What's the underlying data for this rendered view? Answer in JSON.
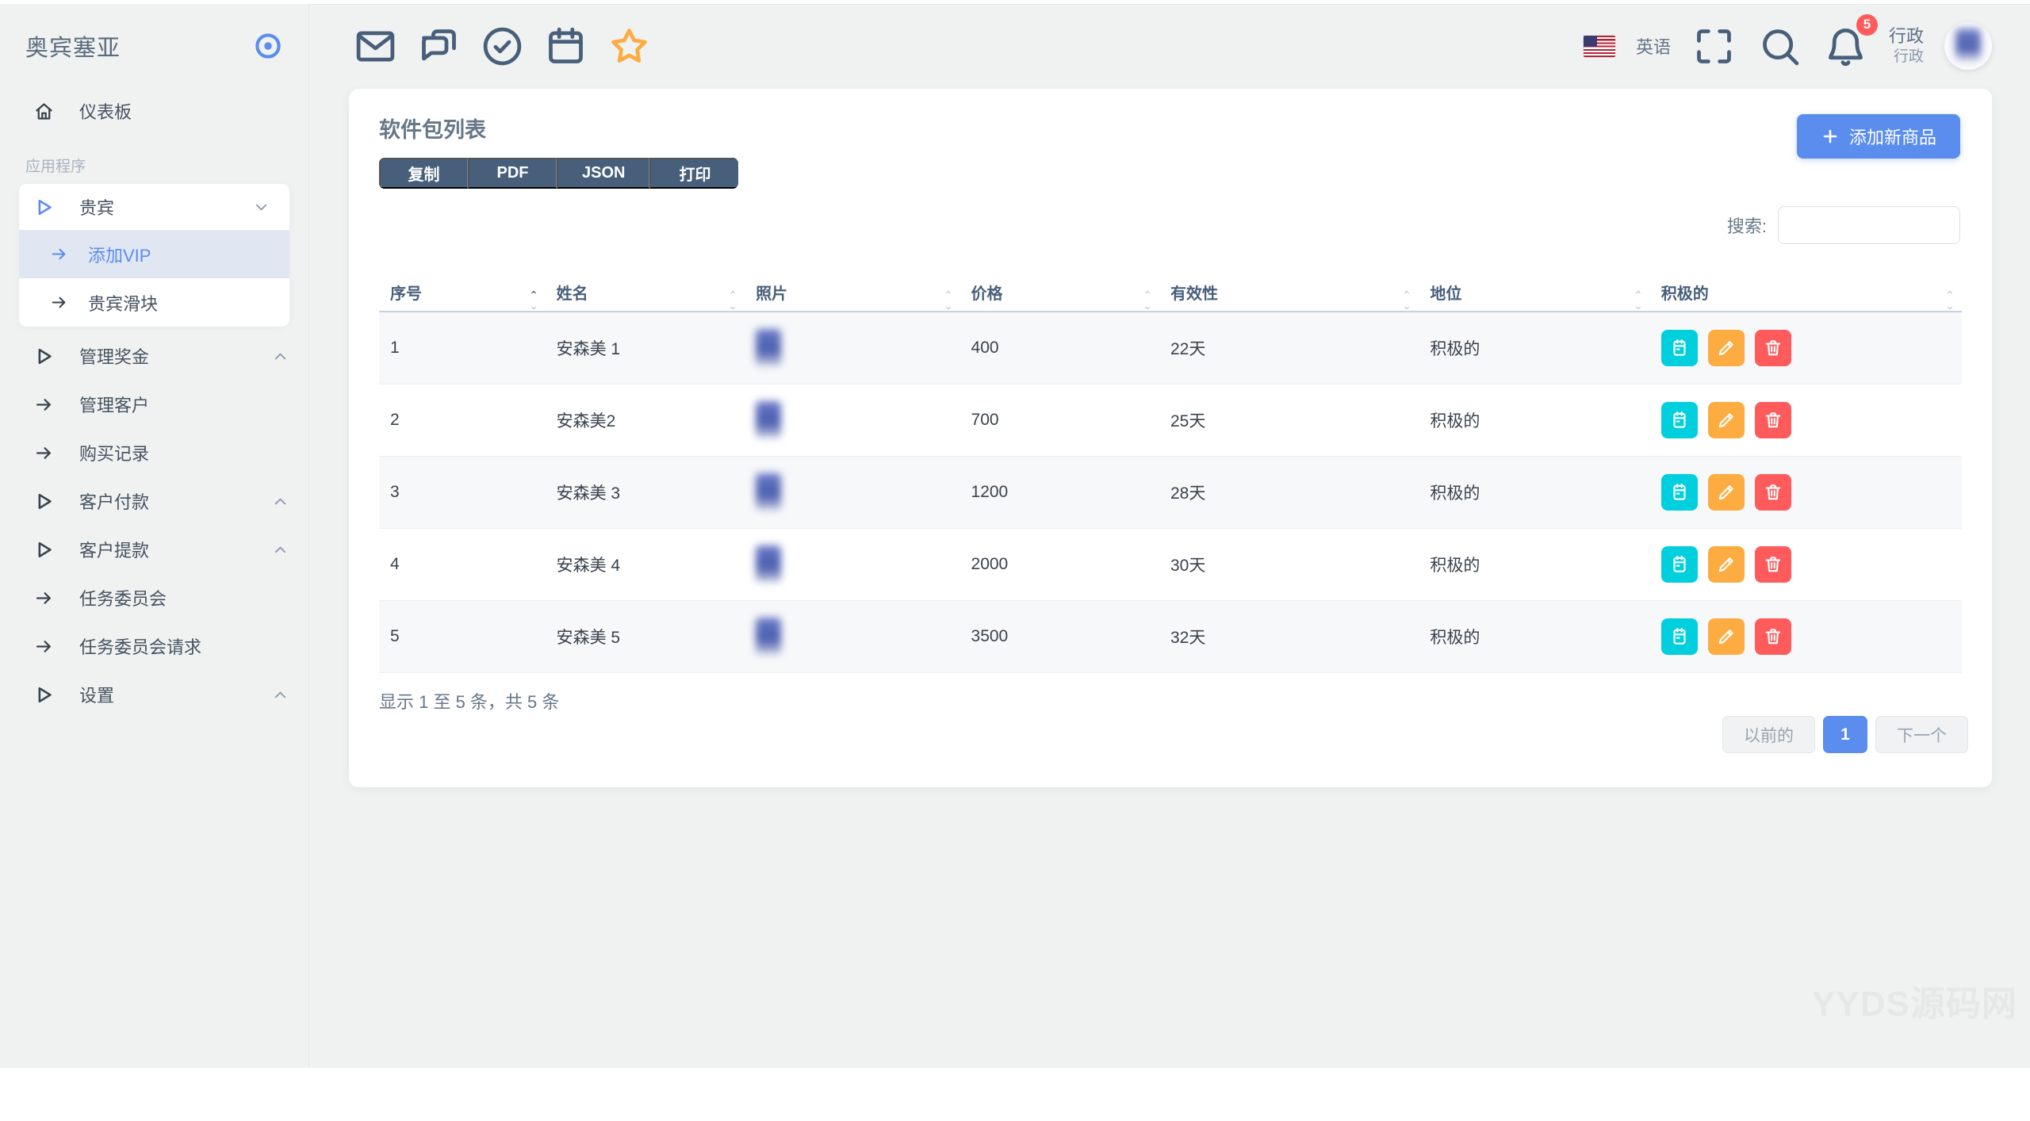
{
  "colors": {
    "primary": "#5a8dee",
    "secondary": "#475f7b",
    "info": "#00cfdd",
    "warning": "#fdac41",
    "danger": "#ff5b5c",
    "page_bg": "#f0f2f2",
    "active_subitem_bg": "#e0e7f2"
  },
  "brand": {
    "name": "奥宾塞亚",
    "toggle_icon": "target-icon"
  },
  "sidebar": {
    "dashboard": {
      "label": "仪表板",
      "icon": "home-icon"
    },
    "section_label": "应用程序",
    "items": [
      {
        "label": "贵宾",
        "icon": "play-icon",
        "chevron": "down",
        "group_active": true,
        "children": [
          {
            "label": "添加VIP",
            "icon": "arrow-right-icon",
            "active": true
          },
          {
            "label": "贵宾滑块",
            "icon": "arrow-right-icon",
            "active": false
          }
        ]
      },
      {
        "label": "管理奖金",
        "icon": "play-icon",
        "chevron": "up"
      },
      {
        "label": "管理客户",
        "icon": "arrow-right-icon",
        "chevron": null
      },
      {
        "label": "购买记录",
        "icon": "arrow-right-icon",
        "chevron": null
      },
      {
        "label": "客户付款",
        "icon": "play-icon",
        "chevron": "up"
      },
      {
        "label": "客户提款",
        "icon": "play-icon",
        "chevron": "up"
      },
      {
        "label": "任务委员会",
        "icon": "arrow-right-icon",
        "chevron": null
      },
      {
        "label": "任务委员会请求",
        "icon": "arrow-right-icon",
        "chevron": null
      },
      {
        "label": "设置",
        "icon": "play-icon",
        "chevron": "up"
      }
    ]
  },
  "header": {
    "left_icons": [
      "mail-icon",
      "chat-icon",
      "check-circle-icon",
      "calendar-icon",
      "star-icon"
    ],
    "language": "英语",
    "flag_icon": "us-flag-icon",
    "fullscreen_icon": "expand-icon",
    "search_icon": "search-icon",
    "bell_icon": "bell-icon",
    "notification_count": "5",
    "user_name": "行政",
    "user_role": "行政"
  },
  "card": {
    "title": "软件包列表",
    "export_buttons": [
      "复制",
      "PDF",
      "JSON",
      "打印"
    ],
    "add_button": {
      "icon": "plus-icon",
      "label": "添加新商品"
    },
    "search_label": "搜索:",
    "search_value": "",
    "table": {
      "headers": [
        {
          "label": "序号",
          "sorted": true
        },
        {
          "label": "姓名",
          "sorted": false
        },
        {
          "label": "照片",
          "sorted": false
        },
        {
          "label": "价格",
          "sorted": false
        },
        {
          "label": "有效性",
          "sorted": false
        },
        {
          "label": "地位",
          "sorted": false
        },
        {
          "label": "积极的",
          "sorted": false
        }
      ],
      "rows": [
        {
          "sn": "1",
          "name": "安森美 1",
          "price": "400",
          "validity": "22天",
          "status": "积极的"
        },
        {
          "sn": "2",
          "name": "安森美2",
          "price": "700",
          "validity": "25天",
          "status": "积极的"
        },
        {
          "sn": "3",
          "name": "安森美 3",
          "price": "1200",
          "validity": "28天",
          "status": "积极的"
        },
        {
          "sn": "4",
          "name": "安森美 4",
          "price": "2000",
          "validity": "30天",
          "status": "积极的"
        },
        {
          "sn": "5",
          "name": "安森美 5",
          "price": "3500",
          "validity": "32天",
          "status": "积极的"
        }
      ],
      "row_actions": [
        {
          "name": "notepad-button",
          "icon": "notepad-icon",
          "style": "info"
        },
        {
          "name": "edit-button",
          "icon": "pencil-icon",
          "style": "warn"
        },
        {
          "name": "delete-button",
          "icon": "trash-icon",
          "style": "danger"
        }
      ]
    },
    "footer_info": "显示 1 至 5 条，共 5 条",
    "pagination": {
      "prev": "以前的",
      "page": "1",
      "next": "下一个"
    }
  },
  "watermark": "YYDS源码网"
}
